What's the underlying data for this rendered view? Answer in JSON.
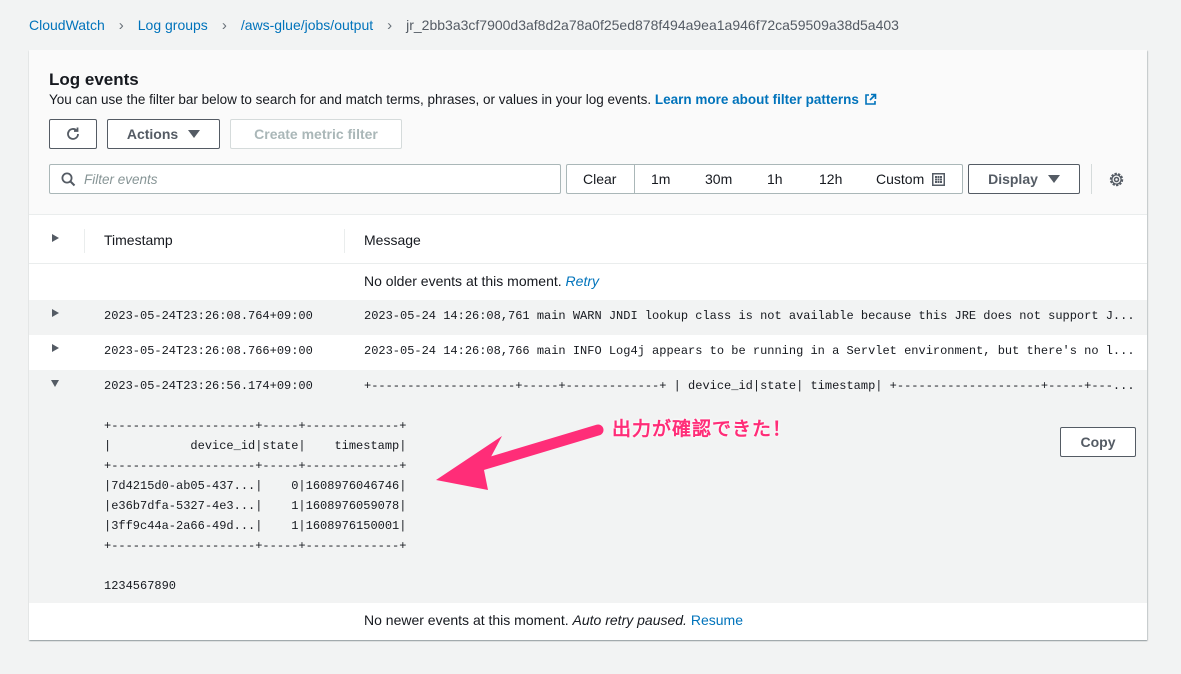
{
  "breadcrumb": {
    "items": [
      "CloudWatch",
      "Log groups",
      "/aws-glue/jobs/output"
    ],
    "current": "jr_2bb3a3cf7900d3af8d2a78a0f25ed878f494a9ea1a946f72ca59509a38d5a403"
  },
  "header": {
    "title": "Log events",
    "description": "You can use the filter bar below to search for and match terms, phrases, or values in your log events.",
    "learn_more": "Learn more about filter patterns"
  },
  "toolbar": {
    "actions_label": "Actions",
    "create_metric_filter_label": "Create metric filter"
  },
  "filter": {
    "placeholder": "Filter events",
    "clear_label": "Clear",
    "ranges": [
      "1m",
      "30m",
      "1h",
      "12h"
    ],
    "custom_label": "Custom",
    "display_label": "Display"
  },
  "table": {
    "headers": {
      "timestamp": "Timestamp",
      "message": "Message"
    },
    "older_text": "No older events at this moment.",
    "retry_label": "Retry",
    "rows": [
      {
        "timestamp": "2023-05-24T23:26:08.764+09:00",
        "message": "2023-05-24 14:26:08,761 main WARN JNDI lookup class is not available because this JRE does not support J..."
      },
      {
        "timestamp": "2023-05-24T23:26:08.766+09:00",
        "message": "2023-05-24 14:26:08,766 main INFO Log4j appears to be running in a Servlet environment, but there's no l..."
      },
      {
        "timestamp": "2023-05-24T23:26:56.174+09:00",
        "message": "+--------------------+-----+-------------+ | device_id|state| timestamp| +--------------------+-----+---..."
      }
    ],
    "expanded_lines": [
      "+--------------------+-----+-------------+",
      "|           device_id|state|    timestamp|",
      "+--------------------+-----+-------------+",
      "|7d4215d0-ab05-437...|    0|1608976046746|",
      "|e36b7dfa-5327-4e3...|    1|1608976059078|",
      "|3ff9c44a-2a66-49d...|    1|1608976150001|",
      "+--------------------+-----+-------------+",
      "",
      "1234567890"
    ],
    "copy_label": "Copy",
    "newer_text": "No newer events at this moment.",
    "auto_retry_text": "Auto retry paused.",
    "resume_label": "Resume"
  },
  "annotation": {
    "text": "出力が確認できた！",
    "color": "#ff2d78"
  },
  "colors": {
    "link": "#0073bb",
    "text": "#16191f",
    "muted": "#545b64",
    "background": "#f2f3f3"
  }
}
